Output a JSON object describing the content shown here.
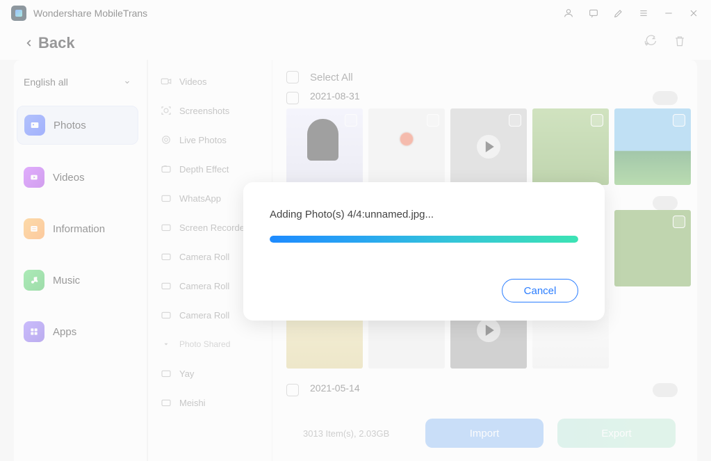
{
  "app": {
    "title": "Wondershare MobileTrans",
    "back_label": "Back"
  },
  "sidebar": {
    "dropdown_label": "English all",
    "items": [
      {
        "label": "Photos"
      },
      {
        "label": "Videos"
      },
      {
        "label": "Information"
      },
      {
        "label": "Music"
      },
      {
        "label": "Apps"
      }
    ]
  },
  "albums": [
    "Videos",
    "Screenshots",
    "Live Photos",
    "Depth Effect",
    "WhatsApp",
    "Screen Recorder",
    "Camera Roll",
    "Camera Roll",
    "Camera Roll"
  ],
  "albums_section_header": "Photo Shared",
  "albums_b": [
    "Yay",
    "Meishi"
  ],
  "content": {
    "select_all_label": "Select All",
    "date_groups": [
      {
        "date": "2021-08-31"
      },
      {
        "date": "2021-05-14"
      }
    ]
  },
  "modal": {
    "message": "Adding Photo(s) 4/4:unnamed.jpg...",
    "cancel_label": "Cancel"
  },
  "footer": {
    "status": "3013 Item(s), 2.03GB",
    "import_label": "Import",
    "export_label": "Export"
  }
}
